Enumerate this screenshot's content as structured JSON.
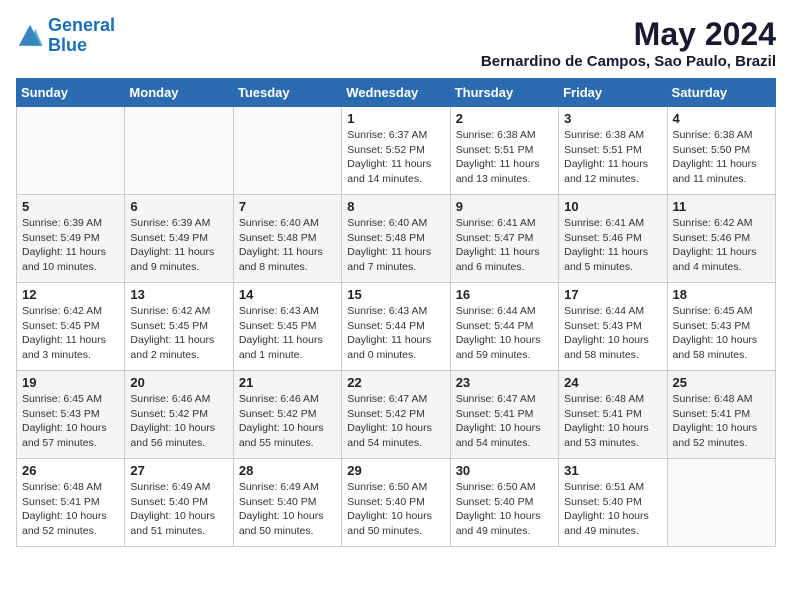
{
  "header": {
    "logo_line1": "General",
    "logo_line2": "Blue",
    "month_year": "May 2024",
    "location": "Bernardino de Campos, Sao Paulo, Brazil"
  },
  "days_of_week": [
    "Sunday",
    "Monday",
    "Tuesday",
    "Wednesday",
    "Thursday",
    "Friday",
    "Saturday"
  ],
  "weeks": [
    [
      {
        "day": "",
        "info": ""
      },
      {
        "day": "",
        "info": ""
      },
      {
        "day": "",
        "info": ""
      },
      {
        "day": "1",
        "info": "Sunrise: 6:37 AM\nSunset: 5:52 PM\nDaylight: 11 hours and 14 minutes."
      },
      {
        "day": "2",
        "info": "Sunrise: 6:38 AM\nSunset: 5:51 PM\nDaylight: 11 hours and 13 minutes."
      },
      {
        "day": "3",
        "info": "Sunrise: 6:38 AM\nSunset: 5:51 PM\nDaylight: 11 hours and 12 minutes."
      },
      {
        "day": "4",
        "info": "Sunrise: 6:38 AM\nSunset: 5:50 PM\nDaylight: 11 hours and 11 minutes."
      }
    ],
    [
      {
        "day": "5",
        "info": "Sunrise: 6:39 AM\nSunset: 5:49 PM\nDaylight: 11 hours and 10 minutes."
      },
      {
        "day": "6",
        "info": "Sunrise: 6:39 AM\nSunset: 5:49 PM\nDaylight: 11 hours and 9 minutes."
      },
      {
        "day": "7",
        "info": "Sunrise: 6:40 AM\nSunset: 5:48 PM\nDaylight: 11 hours and 8 minutes."
      },
      {
        "day": "8",
        "info": "Sunrise: 6:40 AM\nSunset: 5:48 PM\nDaylight: 11 hours and 7 minutes."
      },
      {
        "day": "9",
        "info": "Sunrise: 6:41 AM\nSunset: 5:47 PM\nDaylight: 11 hours and 6 minutes."
      },
      {
        "day": "10",
        "info": "Sunrise: 6:41 AM\nSunset: 5:46 PM\nDaylight: 11 hours and 5 minutes."
      },
      {
        "day": "11",
        "info": "Sunrise: 6:42 AM\nSunset: 5:46 PM\nDaylight: 11 hours and 4 minutes."
      }
    ],
    [
      {
        "day": "12",
        "info": "Sunrise: 6:42 AM\nSunset: 5:45 PM\nDaylight: 11 hours and 3 minutes."
      },
      {
        "day": "13",
        "info": "Sunrise: 6:42 AM\nSunset: 5:45 PM\nDaylight: 11 hours and 2 minutes."
      },
      {
        "day": "14",
        "info": "Sunrise: 6:43 AM\nSunset: 5:45 PM\nDaylight: 11 hours and 1 minute."
      },
      {
        "day": "15",
        "info": "Sunrise: 6:43 AM\nSunset: 5:44 PM\nDaylight: 11 hours and 0 minutes."
      },
      {
        "day": "16",
        "info": "Sunrise: 6:44 AM\nSunset: 5:44 PM\nDaylight: 10 hours and 59 minutes."
      },
      {
        "day": "17",
        "info": "Sunrise: 6:44 AM\nSunset: 5:43 PM\nDaylight: 10 hours and 58 minutes."
      },
      {
        "day": "18",
        "info": "Sunrise: 6:45 AM\nSunset: 5:43 PM\nDaylight: 10 hours and 58 minutes."
      }
    ],
    [
      {
        "day": "19",
        "info": "Sunrise: 6:45 AM\nSunset: 5:43 PM\nDaylight: 10 hours and 57 minutes."
      },
      {
        "day": "20",
        "info": "Sunrise: 6:46 AM\nSunset: 5:42 PM\nDaylight: 10 hours and 56 minutes."
      },
      {
        "day": "21",
        "info": "Sunrise: 6:46 AM\nSunset: 5:42 PM\nDaylight: 10 hours and 55 minutes."
      },
      {
        "day": "22",
        "info": "Sunrise: 6:47 AM\nSunset: 5:42 PM\nDaylight: 10 hours and 54 minutes."
      },
      {
        "day": "23",
        "info": "Sunrise: 6:47 AM\nSunset: 5:41 PM\nDaylight: 10 hours and 54 minutes."
      },
      {
        "day": "24",
        "info": "Sunrise: 6:48 AM\nSunset: 5:41 PM\nDaylight: 10 hours and 53 minutes."
      },
      {
        "day": "25",
        "info": "Sunrise: 6:48 AM\nSunset: 5:41 PM\nDaylight: 10 hours and 52 minutes."
      }
    ],
    [
      {
        "day": "26",
        "info": "Sunrise: 6:48 AM\nSunset: 5:41 PM\nDaylight: 10 hours and 52 minutes."
      },
      {
        "day": "27",
        "info": "Sunrise: 6:49 AM\nSunset: 5:40 PM\nDaylight: 10 hours and 51 minutes."
      },
      {
        "day": "28",
        "info": "Sunrise: 6:49 AM\nSunset: 5:40 PM\nDaylight: 10 hours and 50 minutes."
      },
      {
        "day": "29",
        "info": "Sunrise: 6:50 AM\nSunset: 5:40 PM\nDaylight: 10 hours and 50 minutes."
      },
      {
        "day": "30",
        "info": "Sunrise: 6:50 AM\nSunset: 5:40 PM\nDaylight: 10 hours and 49 minutes."
      },
      {
        "day": "31",
        "info": "Sunrise: 6:51 AM\nSunset: 5:40 PM\nDaylight: 10 hours and 49 minutes."
      },
      {
        "day": "",
        "info": ""
      }
    ]
  ]
}
